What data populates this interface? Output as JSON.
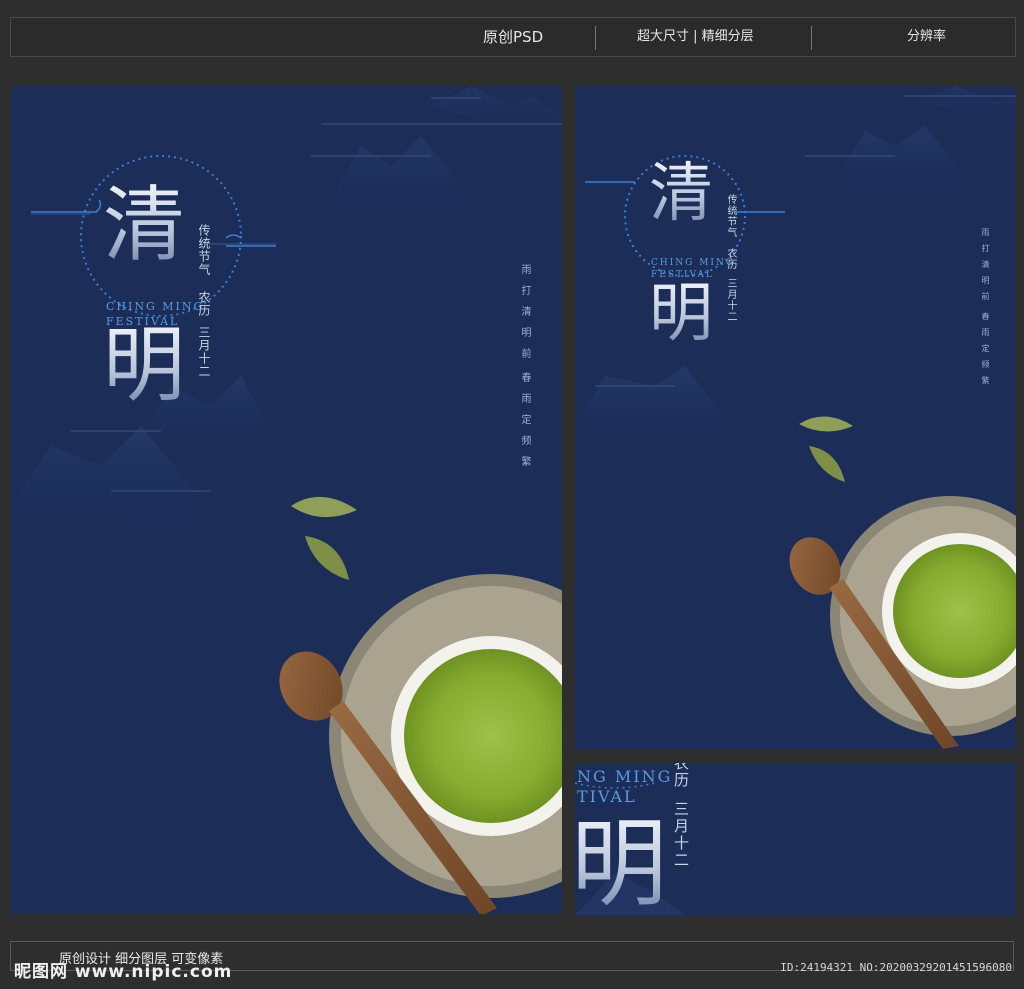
{
  "topbar": {
    "original_psd": "原创PSD",
    "size_layers": "超大尺寸 | 精细分层",
    "resolution": "分辨率"
  },
  "poster": {
    "char1": "清",
    "char2": "明",
    "english_line1": "CHING MING",
    "english_line2": "FESTIVAL",
    "col_traditional": "传统节气",
    "col_lunar": "农历",
    "col_date": "三月十二",
    "poem_line1": "雨打清明前",
    "poem_line2": "春雨定频繁"
  },
  "crop": {
    "english_line1": "NG MING",
    "english_line2": "TIVAL",
    "col_lunar": "农历",
    "col_date": "三月十二",
    "char2": "明"
  },
  "bottom": {
    "caption": "原创设计 细分图层 可变像素",
    "watermark": "昵图网 www.nipic.com",
    "id_line": "ID:24194321 NO:20200329201451596080"
  },
  "colors": {
    "background": "#2e2e2e",
    "poster_navy": "#1c2d58",
    "accent_blue": "#5a9be0",
    "matcha_green": "#8fb23a",
    "wood": "#8a5a35"
  }
}
